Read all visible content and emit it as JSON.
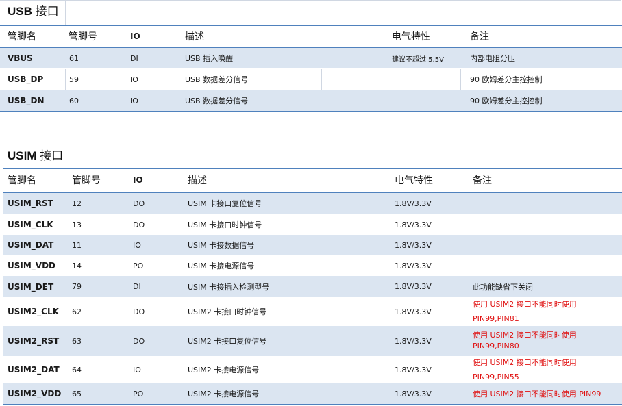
{
  "usb": {
    "title_latin": "USB",
    "title_cn": "接口",
    "headers": [
      "管脚名",
      "管脚号",
      "IO",
      "描述",
      "电气特性",
      "备注"
    ],
    "rows": [
      {
        "name": "VBUS",
        "pin": "61",
        "io": "DI",
        "desc": "USB 插入唤醒",
        "elec": "建议不超过  5.5V",
        "note": "内部电阻分压"
      },
      {
        "name": "USB_DP",
        "pin": "59",
        "io": "IO",
        "desc": "USB 数据差分信号",
        "elec": "",
        "note": "90 欧姆差分主控控制"
      },
      {
        "name": "USB_DN",
        "pin": "60",
        "io": "IO",
        "desc": "USB 数据差分信号",
        "elec": "",
        "note": "90 欧姆差分主控控制"
      }
    ]
  },
  "usim": {
    "title_latin": "USIM",
    "title_cn": "接口",
    "headers": [
      "管脚名",
      "管脚号",
      "IO",
      "描述",
      "电气特性",
      "备注"
    ],
    "rows": [
      {
        "name": "USIM_RST",
        "pin": "12",
        "io": "DO",
        "desc": "USIM 卡接口复位信号",
        "elec": "1.8V/3.3V",
        "note": ""
      },
      {
        "name": "USIM_CLK",
        "pin": "13",
        "io": "DO",
        "desc": "USIM 卡接口时钟信号",
        "elec": "1.8V/3.3V",
        "note": ""
      },
      {
        "name": "USIM_DAT",
        "pin": "11",
        "io": "IO",
        "desc": "USIM 卡接数据信号",
        "elec": "1.8V/3.3V",
        "note": ""
      },
      {
        "name": "USIM_VDD",
        "pin": "14",
        "io": "PO",
        "desc": "USIM 卡接电源信号",
        "elec": "1.8V/3.3V",
        "note": ""
      },
      {
        "name": "USIM_DET",
        "pin": "79",
        "io": "DI",
        "desc": "USIM 卡接插入检测型号",
        "elec": "1.8V/3.3V",
        "note": "此功能缺省下关闭"
      },
      {
        "name": "USIM2_CLK",
        "pin": "62",
        "io": "DO",
        "desc": "USIM2 卡接口时钟信号",
        "elec": "1.8V/3.3V",
        "note_line1": "使用 USIM2 接口不能同时使用",
        "note_line2": "PIN99,PIN81"
      },
      {
        "name": "USIM2_RST",
        "pin": "63",
        "io": "DO",
        "desc": "USIM2 卡接口复位信号",
        "elec": "1.8V/3.3V",
        "note_line1": "使用 USIM2 接口不能同时使用",
        "note_line2": "PIN99,PIN80"
      },
      {
        "name": "USIM2_DAT",
        "pin": "64",
        "io": "IO",
        "desc": "USIM2 卡接电源信号",
        "elec": "1.8V/3.3V",
        "note_line1": "使用 USIM2 接口不能同时使用",
        "note_line2": "PIN99,PIN55"
      },
      {
        "name": "USIM2_VDD",
        "pin": "65",
        "io": "PO",
        "desc": "USIM2 卡接电源信号",
        "elec": "1.8V/3.3V",
        "note": "使用 USIM2 接口不能同时使用 PIN99"
      }
    ]
  }
}
